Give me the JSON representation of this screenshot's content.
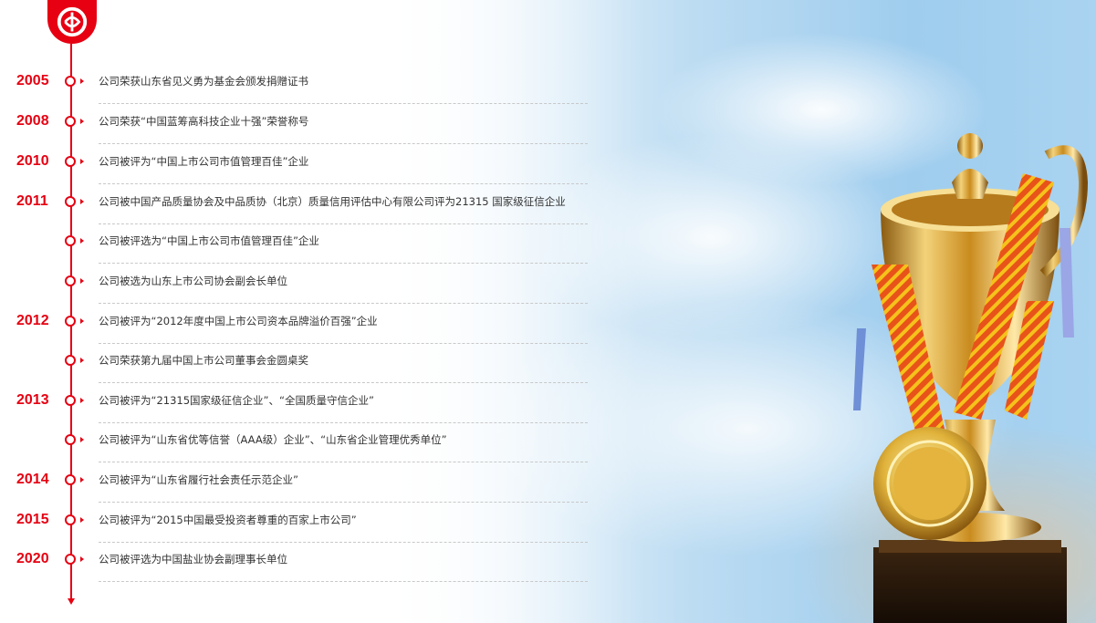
{
  "colors": {
    "accent": "#e60012",
    "text": "#333333",
    "separator": "#c8c8c8"
  },
  "logo": {
    "icon": "company-logo-icon"
  },
  "timeline": [
    {
      "year": "2005",
      "text": "公司荣获山东省见义勇为基金会颁发捐赠证书"
    },
    {
      "year": "2008",
      "text": "公司荣获“中国蓝筹高科技企业十强”荣誉称号"
    },
    {
      "year": "2010",
      "text": "公司被评为“中国上市公司市值管理百佳”企业"
    },
    {
      "year": "2011",
      "text": "公司被中国产品质量协会及中品质协（北京）质量信用评估中心有限公司评为21315 国家级征信企业"
    },
    {
      "year": "",
      "text": "公司被评选为“中国上市公司市值管理百佳”企业"
    },
    {
      "year": "",
      "text": "公司被选为山东上市公司协会副会长单位"
    },
    {
      "year": "2012",
      "text": "公司被评为“2012年度中国上市公司资本品牌溢价百强”企业"
    },
    {
      "year": "",
      "text": "公司荣获第九届中国上市公司董事会金圆桌奖"
    },
    {
      "year": "2013",
      "text": "公司被评为“21315国家级征信企业”、“全国质量守信企业”"
    },
    {
      "year": "",
      "text": "公司被评为“山东省优等信誉（AAA级）企业”、“山东省企业管理优秀单位”"
    },
    {
      "year": "2014",
      "text": "公司被评为“山东省履行社会责任示范企业”"
    },
    {
      "year": "2015",
      "text": "公司被评为“2015中国最受投资者尊重的百家上市公司”"
    },
    {
      "year": "2020",
      "text": "公司被评选为中国盐业协会副理事长单位"
    }
  ]
}
